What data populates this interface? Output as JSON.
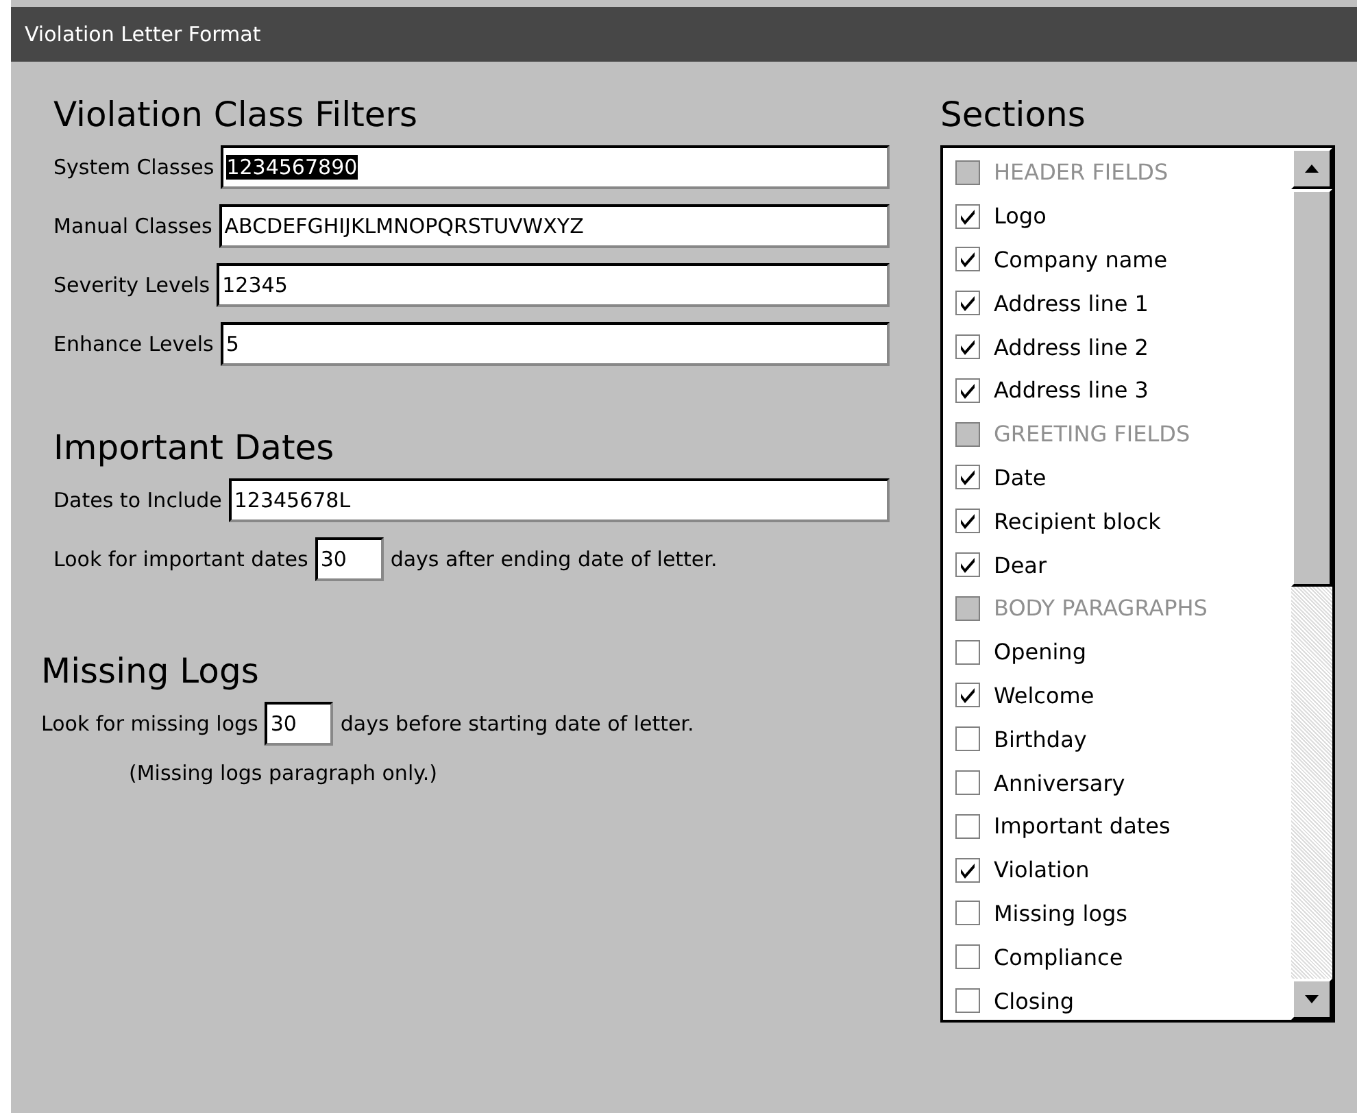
{
  "window": {
    "title": "Violation Letter Format"
  },
  "class_filters": {
    "heading": "Violation Class Filters",
    "fields": [
      {
        "label": "System Classes",
        "value": "1234567890",
        "highlighted": true
      },
      {
        "label": "Manual Classes",
        "value": "ABCDEFGHIJKLMNOPQRSTUVWXYZ",
        "highlighted": false
      },
      {
        "label": "Severity Levels",
        "value": "12345",
        "highlighted": false
      },
      {
        "label": "Enhance Levels",
        "value": "5",
        "highlighted": false
      }
    ]
  },
  "important_dates": {
    "heading": "Important Dates",
    "field": {
      "label": "Dates to Include",
      "value": "12345678L"
    },
    "lookahead": {
      "before": "Look for important dates",
      "value": "30",
      "after": "days after ending date of letter."
    }
  },
  "missing_logs": {
    "heading": "Missing Logs",
    "lookback": {
      "before": "Look for missing logs",
      "value": "30",
      "after": "days before starting date of letter."
    },
    "note": "(Missing logs paragraph only.)"
  },
  "sections": {
    "heading": "Sections",
    "items": [
      {
        "kind": "group",
        "label": "HEADER FIELDS",
        "disabled": true
      },
      {
        "kind": "item",
        "label": "Logo",
        "checked": true
      },
      {
        "kind": "item",
        "label": "Company name",
        "checked": true
      },
      {
        "kind": "item",
        "label": "Address line 1",
        "checked": true
      },
      {
        "kind": "item",
        "label": "Address line 2",
        "checked": true
      },
      {
        "kind": "item",
        "label": "Address line 3",
        "checked": true
      },
      {
        "kind": "group",
        "label": "GREETING FIELDS",
        "disabled": true
      },
      {
        "kind": "item",
        "label": "Date",
        "checked": true
      },
      {
        "kind": "item",
        "label": "Recipient block",
        "checked": true
      },
      {
        "kind": "item",
        "label": "Dear",
        "checked": true
      },
      {
        "kind": "group",
        "label": "BODY PARAGRAPHS",
        "disabled": true
      },
      {
        "kind": "item",
        "label": "Opening",
        "checked": false
      },
      {
        "kind": "item",
        "label": "Welcome",
        "checked": true
      },
      {
        "kind": "item",
        "label": "Birthday",
        "checked": false
      },
      {
        "kind": "item",
        "label": "Anniversary",
        "checked": false
      },
      {
        "kind": "item",
        "label": "Important dates",
        "checked": false
      },
      {
        "kind": "item",
        "label": "Violation",
        "checked": true
      },
      {
        "kind": "item",
        "label": "Missing logs",
        "checked": false
      },
      {
        "kind": "item",
        "label": "Compliance",
        "checked": false
      },
      {
        "kind": "item",
        "label": "Closing",
        "checked": false
      }
    ]
  }
}
